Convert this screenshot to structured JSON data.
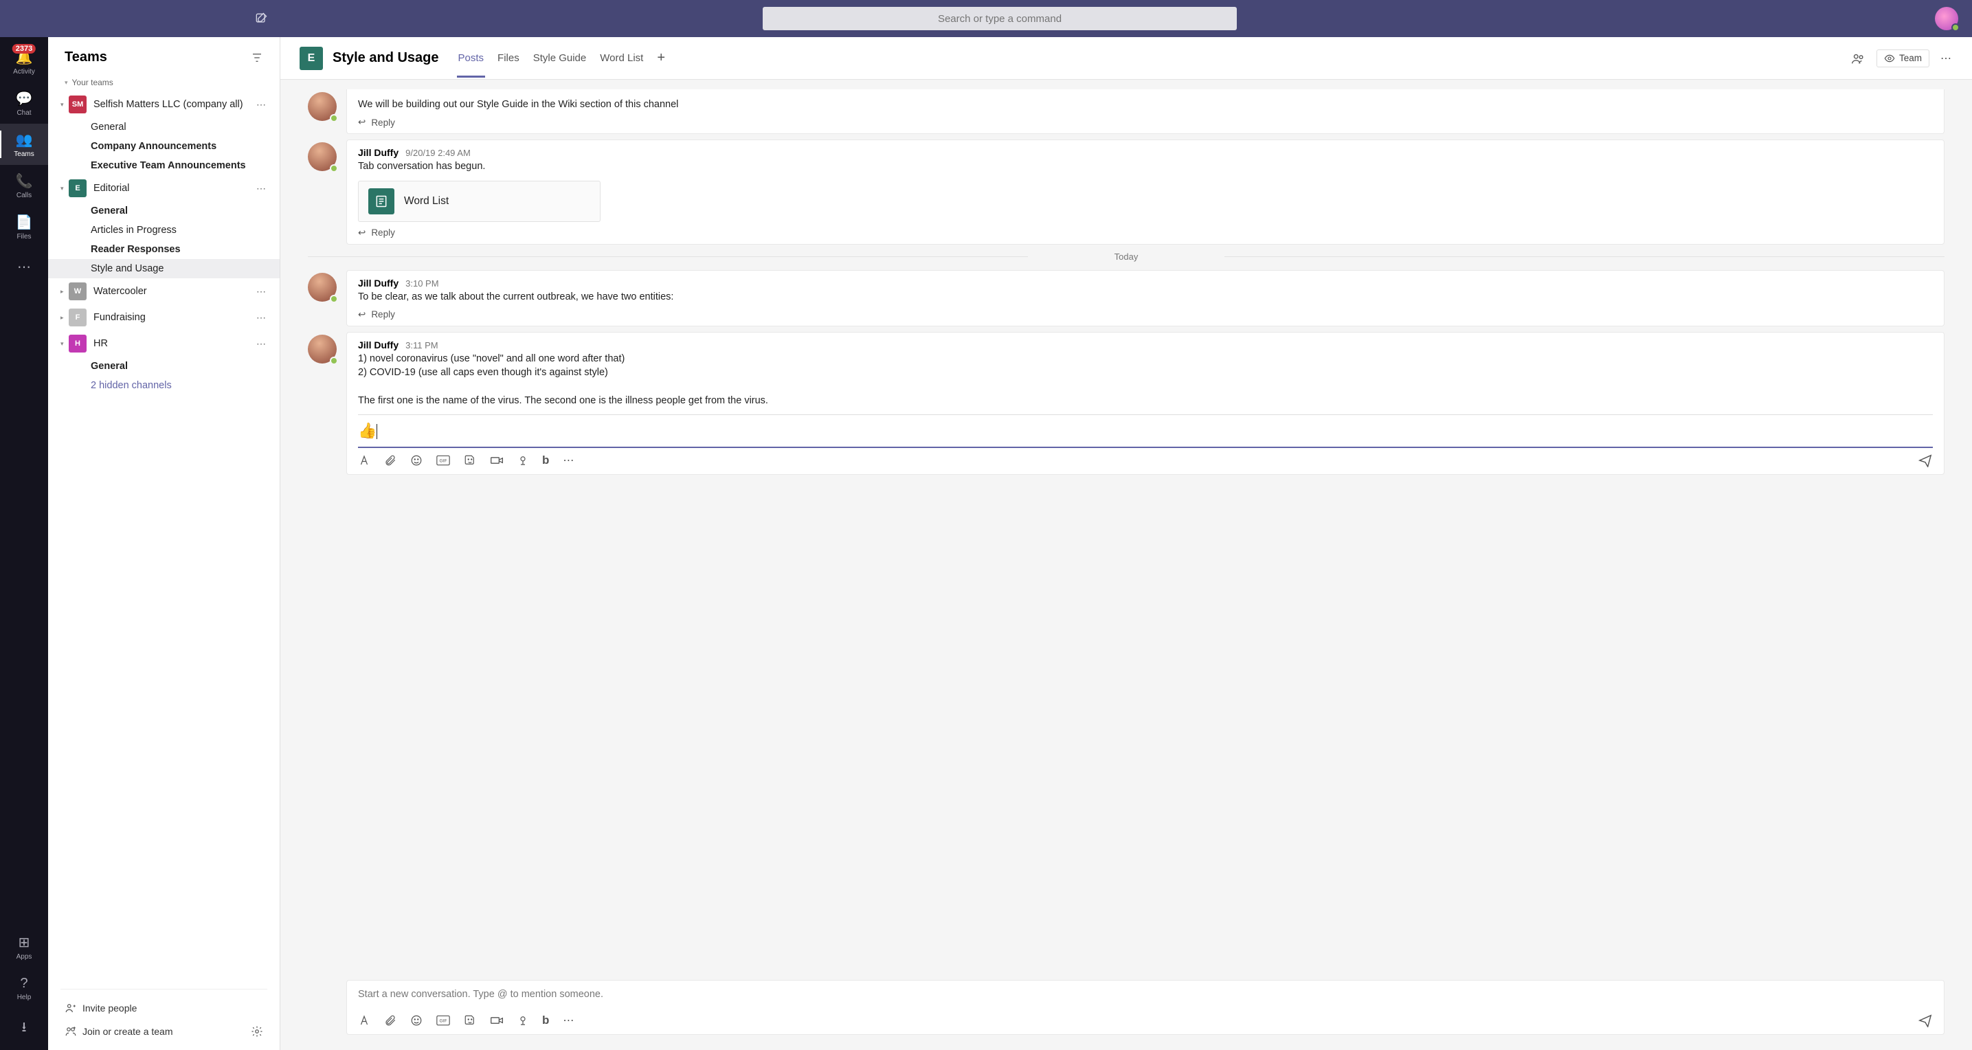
{
  "search": {
    "placeholder": "Search or type a command"
  },
  "rail": {
    "activity": "Activity",
    "activity_badge": "2373",
    "chat": "Chat",
    "teams": "Teams",
    "calls": "Calls",
    "files": "Files",
    "apps": "Apps",
    "help": "Help"
  },
  "teams_panel": {
    "title": "Teams",
    "your_teams": "Your teams",
    "teams": [
      {
        "initials": "SM",
        "color": "#c4314b",
        "name": "Selfish Matters LLC (company all)",
        "expanded": true,
        "channels": [
          {
            "name": "General",
            "bold": false
          },
          {
            "name": "Company Announcements",
            "bold": true
          },
          {
            "name": "Executive Team Announcements",
            "bold": true
          }
        ]
      },
      {
        "initials": "E",
        "color": "#2b7566",
        "name": "Editorial",
        "expanded": true,
        "channels": [
          {
            "name": "General",
            "bold": true
          },
          {
            "name": "Articles in Progress",
            "bold": false
          },
          {
            "name": "Reader Responses",
            "bold": true
          },
          {
            "name": "Style and Usage",
            "bold": false,
            "selected": true
          }
        ]
      },
      {
        "initials": "W",
        "color": "#9c9c9c",
        "name": "Watercooler",
        "expanded": false
      },
      {
        "initials": "F",
        "color": "#bfbfbf",
        "name": "Fundraising",
        "expanded": false
      },
      {
        "initials": "H",
        "color": "#c239b3",
        "name": "HR",
        "expanded": true,
        "channels": [
          {
            "name": "General",
            "bold": true
          },
          {
            "name": "2 hidden channels",
            "link": true
          }
        ]
      }
    ],
    "invite": "Invite people",
    "join": "Join or create a team"
  },
  "channel_header": {
    "tile": "E",
    "title": "Style and Usage",
    "tabs": [
      "Posts",
      "Files",
      "Style Guide",
      "Word List"
    ],
    "active_tab": "Posts",
    "team_pill": "Team"
  },
  "messages": {
    "m0_text": "We will be building out our Style Guide in the Wiki section of this channel",
    "reply": "Reply",
    "m1_author": "Jill Duffy",
    "m1_time": "9/20/19 2:49 AM",
    "m1_text": "Tab conversation has begun.",
    "m1_card": "Word List",
    "divider": "Today",
    "m2_author": "Jill Duffy",
    "m2_time": "3:10 PM",
    "m2_text": "To be clear, as we talk about the current outbreak, we have two entities:",
    "m3_author": "Jill Duffy",
    "m3_time": "3:11 PM",
    "m3_line1": "1) novel coronavirus (use \"novel\" and all one word after that)",
    "m3_line2": "2) COVID-19 (use all caps even though it's against style)",
    "m3_line3": "The first one is the name of the virus. The second one is the illness people get from the virus.",
    "compose_emoji": "👍"
  },
  "bottom_compose": {
    "placeholder": "Start a new conversation. Type @ to mention someone."
  }
}
